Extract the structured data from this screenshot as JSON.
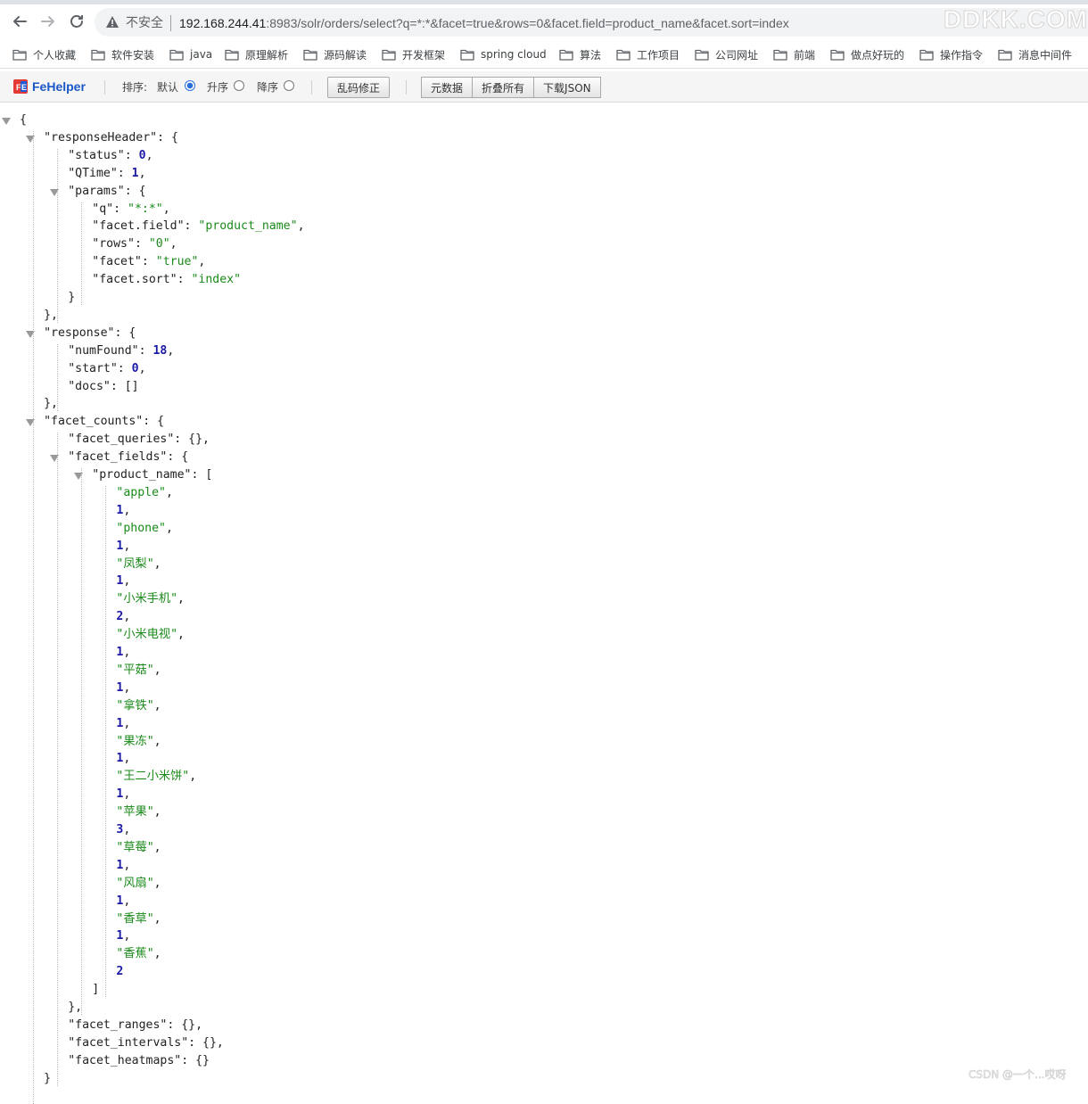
{
  "browser": {
    "insecure_label": "不安全",
    "url_host": "192.168.244.41",
    "url_rest": ":8983/solr/orders/select?q=*:*&facet=true&rows=0&facet.field=product_name&facet.sort=index",
    "watermark": "DDKK.COM"
  },
  "bookmarks": [
    "个人收藏",
    "软件安装",
    "java",
    "原理解析",
    "源码解读",
    "开发框架",
    "spring cloud",
    "算法",
    "工作项目",
    "公司网址",
    "前端",
    "做点好玩的",
    "操作指令",
    "消息中间件"
  ],
  "fehelper": {
    "title": "FeHelper",
    "sort_label": "排序:",
    "opt_default": "默认",
    "opt_asc": "升序",
    "opt_desc": "降序",
    "fix_button": "乱码修正",
    "raw_button": "元数据",
    "collapse_button": "折叠所有",
    "download_button": "下载JSON"
  },
  "json": {
    "responseHeader": {
      "status": "0",
      "QTime": "1",
      "params": {
        "q": "*:*",
        "facet.field": "product_name",
        "rows": "0",
        "facet": "true",
        "facet.sort": "index"
      }
    },
    "response": {
      "numFound": "18",
      "start": "0",
      "docs": "[]"
    },
    "facet_counts": {
      "facet_queries": "{}",
      "product_name": [
        {
          "name": "apple",
          "count": "1"
        },
        {
          "name": "phone",
          "count": "1"
        },
        {
          "name": "凤梨",
          "count": "1"
        },
        {
          "name": "小米手机",
          "count": "2"
        },
        {
          "name": "小米电视",
          "count": "1"
        },
        {
          "name": "平菇",
          "count": "1"
        },
        {
          "name": "拿铁",
          "count": "1"
        },
        {
          "name": "果冻",
          "count": "1"
        },
        {
          "name": "王二小米饼",
          "count": "1"
        },
        {
          "name": "苹果",
          "count": "3"
        },
        {
          "name": "草莓",
          "count": "1"
        },
        {
          "name": "风扇",
          "count": "1"
        },
        {
          "name": "香草",
          "count": "1"
        },
        {
          "name": "香蕉",
          "count": "2"
        }
      ],
      "facet_ranges": "{}",
      "facet_intervals": "{}",
      "facet_heatmaps": "{}"
    }
  },
  "footer_watermark": "CSDN @一个...哎呀"
}
